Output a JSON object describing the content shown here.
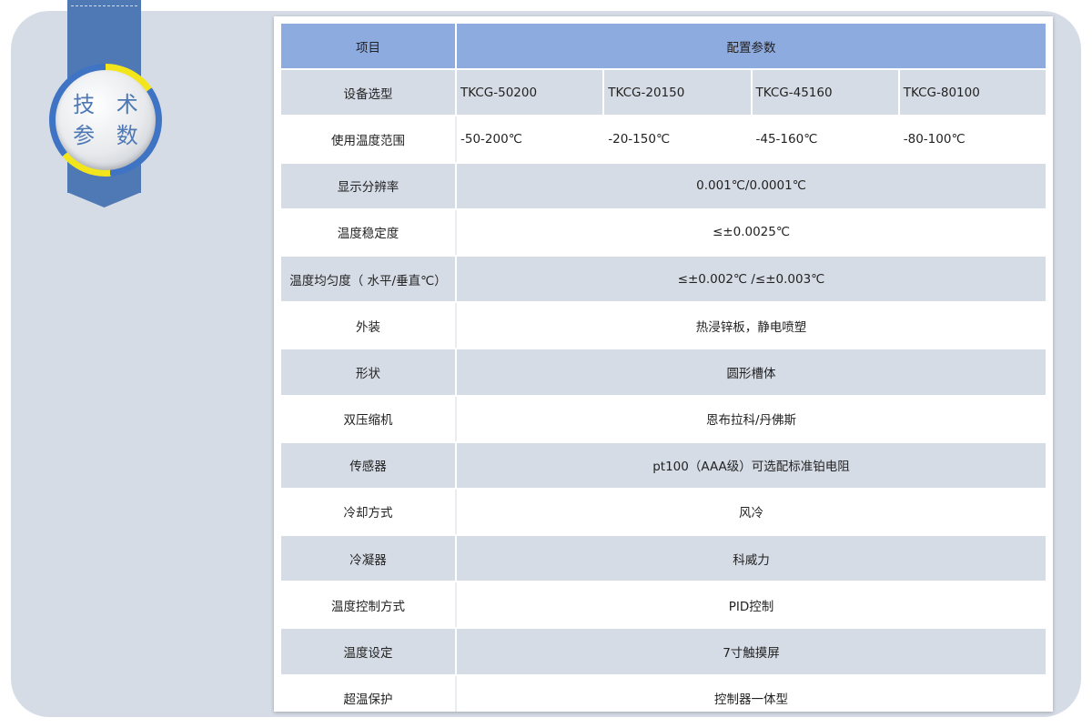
{
  "badge": {
    "line1": "技 术",
    "line2": "参 数"
  },
  "table": {
    "header": {
      "item": "项目",
      "config": "配置参数"
    },
    "model_row": {
      "label": "设备选型",
      "values": [
        "TKCG-50200",
        "TKCG-20150",
        "TKCG-45160",
        "TKCG-80100"
      ]
    },
    "temp_range_row": {
      "label": "使用温度范围",
      "values": [
        "-50-200℃",
        "-20-150℃",
        "-45-160℃",
        "-80-100℃"
      ]
    },
    "rows": [
      {
        "label": "显示分辨率",
        "value": "0.001℃/0.0001℃"
      },
      {
        "label": "温度稳定度",
        "value": "≤±0.0025℃"
      },
      {
        "label": "温度均匀度（ 水平/垂直℃）",
        "value": "≤±0.002℃ /≤±0.003℃"
      },
      {
        "label": "外装",
        "value": "热浸锌板，静电喷塑"
      },
      {
        "label": "形状",
        "value": "圆形槽体"
      },
      {
        "label": "双压缩机",
        "value": "恩布拉科/丹佛斯"
      },
      {
        "label": "传感器",
        "value": "pt100（AAA级）可选配标准铂电阻"
      },
      {
        "label": "冷却方式",
        "value": "风冷"
      },
      {
        "label": "冷凝器",
        "value": "科威力"
      },
      {
        "label": "温度控制方式",
        "value": "PID控制"
      },
      {
        "label": "温度设定",
        "value": "7寸触摸屏"
      },
      {
        "label": "超温保护",
        "value": "控制器一体型"
      }
    ]
  },
  "colors": {
    "header_bg": "#8eabe0",
    "row_shade": "#d6dce6",
    "ribbon": "#4f79b4",
    "badge_accent": "#f2e51c"
  }
}
